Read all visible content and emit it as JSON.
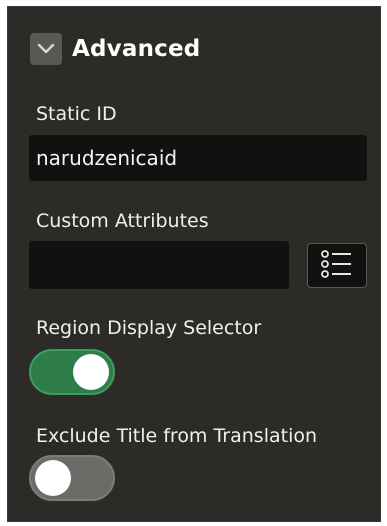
{
  "section": {
    "title": "Advanced",
    "toggle_icon": "chevron-down-icon"
  },
  "static_id": {
    "label": "Static ID",
    "value": "narudzenicaid"
  },
  "custom_attributes": {
    "label": "Custom Attributes",
    "value": "",
    "button_icon": "list-icon"
  },
  "region_display_selector": {
    "label": "Region Display Selector",
    "checked": true
  },
  "exclude_title": {
    "label": "Exclude Title from Translation",
    "checked": false
  },
  "colors": {
    "panel_bg": "#2d2b28",
    "input_bg": "#121110",
    "toggle_on": "#2e7d4a",
    "toggle_off": "#6d6b68"
  }
}
